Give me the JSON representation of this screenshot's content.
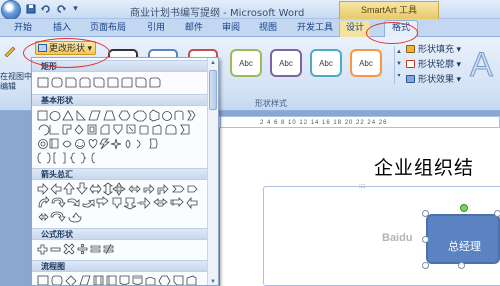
{
  "window": {
    "title": "商业计划书编写提纲 - Microsoft Word",
    "context_tab_group": "SmartArt 工具"
  },
  "quick_access": [
    "save-icon",
    "undo-icon",
    "redo-icon",
    "dropdown-icon"
  ],
  "tabs": [
    {
      "id": "start",
      "label": "开始"
    },
    {
      "id": "insert",
      "label": "插入"
    },
    {
      "id": "layout",
      "label": "页面布局"
    },
    {
      "id": "references",
      "label": "引用"
    },
    {
      "id": "mailings",
      "label": "邮件"
    },
    {
      "id": "review",
      "label": "审阅"
    },
    {
      "id": "view",
      "label": "视图"
    },
    {
      "id": "developer",
      "label": "开发工具"
    },
    {
      "id": "design",
      "label": "设计"
    },
    {
      "id": "format",
      "label": "格式"
    }
  ],
  "active_tab": "格式",
  "ribbon": {
    "left_group_text": [
      "在视图中",
      "编辑"
    ],
    "change_shape_label": "更改形状",
    "style_gallery_items": [
      "Abc",
      "Abc",
      "Abc",
      "Abc",
      "Abc"
    ],
    "shape_fill": "形状填充",
    "shape_outline": "形状轮廓",
    "shape_effects": "形状效果",
    "group_label_shape_styles": "形状样式",
    "big_text_glyph": "A"
  },
  "document": {
    "title": "企业组织结",
    "selected_shape_text": "总经理",
    "watermark": "Baidu",
    "ruler_marks": "2 4 6 8 10 12 14 16 18 20 22 24 26"
  },
  "dropdown": {
    "sections": [
      {
        "label": "矩形"
      },
      {
        "label": "基本形状"
      },
      {
        "label": "箭头总汇"
      },
      {
        "label": "公式形状"
      },
      {
        "label": "流程图"
      }
    ]
  },
  "colors": {
    "accent": "#15428b",
    "shape_fill": "#5b83c1",
    "highlight_red": "#e03030",
    "context_yellow": "#f3e2a0"
  }
}
